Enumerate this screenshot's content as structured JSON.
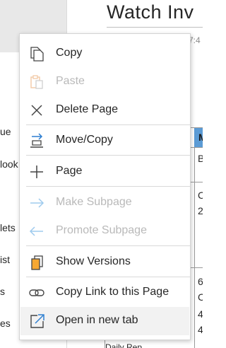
{
  "page": {
    "title": "Watch Inv",
    "meta_fragment": "7:4"
  },
  "sidebar": {
    "fragments": [
      "ue",
      "look",
      "lets",
      "ist",
      "s",
      "es"
    ]
  },
  "table": {
    "header": "M",
    "cells": [
      "B",
      "C",
      "2",
      "6",
      "C",
      "4",
      "4"
    ]
  },
  "bottom_fragment": "Daily Rep",
  "context_menu": {
    "items": [
      {
        "label": "Copy",
        "icon": "copy-icon",
        "enabled": true
      },
      {
        "label": "Paste",
        "icon": "paste-icon",
        "enabled": false
      },
      {
        "label": "Delete Page",
        "icon": "close-icon",
        "enabled": true
      },
      {
        "label": "Move/Copy",
        "icon": "move-copy-icon",
        "enabled": true
      },
      {
        "label": "Page",
        "icon": "plus-icon",
        "enabled": true
      },
      {
        "label": "Make Subpage",
        "icon": "arrow-right-icon",
        "enabled": false
      },
      {
        "label": "Promote Subpage",
        "icon": "arrow-left-icon",
        "enabled": false
      },
      {
        "label": "Show Versions",
        "icon": "versions-icon",
        "enabled": true
      },
      {
        "label": "Copy Link to this Page",
        "icon": "link-icon",
        "enabled": true
      },
      {
        "label": "Open in new tab",
        "icon": "open-new-tab-icon",
        "enabled": true,
        "hovered": true
      }
    ]
  },
  "colors": {
    "accent_blue": "#2e7fd1",
    "icon_gray": "#444444",
    "disabled_blue": "#9fcbee",
    "disabled_text": "#b9b9b9",
    "paste_orange": "#f2c9a6",
    "versions_orange": "#f7a832",
    "table_header": "#5b9bd5"
  }
}
